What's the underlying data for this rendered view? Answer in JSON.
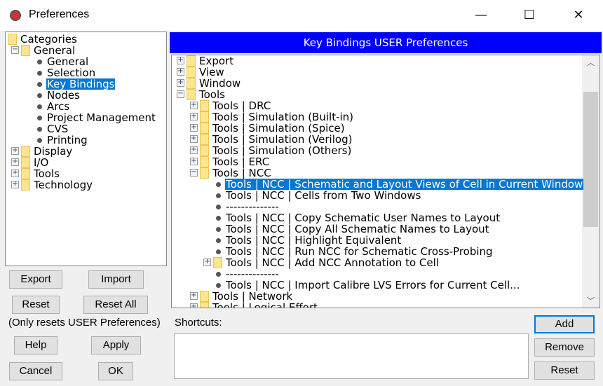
{
  "window": {
    "title": "Preferences",
    "minimize": "—",
    "maximize": "☐",
    "close": "✕"
  },
  "categories": [
    {
      "label": "Categories",
      "level": 0,
      "type": "folder"
    },
    {
      "label": "General",
      "level": 1,
      "type": "folder",
      "expanded": true
    },
    {
      "label": "General",
      "level": 2,
      "type": "leaf"
    },
    {
      "label": "Selection",
      "level": 2,
      "type": "leaf"
    },
    {
      "label": "Key Bindings",
      "level": 2,
      "type": "leaf",
      "selected": true
    },
    {
      "label": "Nodes",
      "level": 2,
      "type": "leaf"
    },
    {
      "label": "Arcs",
      "level": 2,
      "type": "leaf"
    },
    {
      "label": "Project Management",
      "level": 2,
      "type": "leaf"
    },
    {
      "label": "CVS",
      "level": 2,
      "type": "leaf"
    },
    {
      "label": "Printing",
      "level": 2,
      "type": "leaf"
    },
    {
      "label": "Display",
      "level": 1,
      "type": "folder",
      "expanded": false
    },
    {
      "label": "I/O",
      "level": 1,
      "type": "folder",
      "expanded": false
    },
    {
      "label": "Tools",
      "level": 1,
      "type": "folder",
      "expanded": false
    },
    {
      "label": "Technology",
      "level": 1,
      "type": "folder",
      "expanded": false
    }
  ],
  "left_buttons": {
    "export": "Export",
    "import": "Import",
    "reset": "Reset",
    "reset_all": "Reset All",
    "note": "(Only resets USER Preferences)",
    "help": "Help",
    "apply": "Apply",
    "cancel": "Cancel",
    "ok": "OK"
  },
  "header": "Key Bindings USER Preferences",
  "bindings": [
    {
      "label": "Export",
      "level": 0,
      "type": "folder",
      "expanded": false
    },
    {
      "label": "View",
      "level": 0,
      "type": "folder",
      "expanded": false
    },
    {
      "label": "Window",
      "level": 0,
      "type": "folder",
      "expanded": false
    },
    {
      "label": "Tools",
      "level": 0,
      "type": "folder",
      "expanded": true
    },
    {
      "label": "Tools | DRC",
      "level": 1,
      "type": "folder",
      "expanded": false
    },
    {
      "label": "Tools | Simulation (Built-in)",
      "level": 1,
      "type": "folder",
      "expanded": false
    },
    {
      "label": "Tools | Simulation (Spice)",
      "level": 1,
      "type": "folder",
      "expanded": false
    },
    {
      "label": "Tools | Simulation (Verilog)",
      "level": 1,
      "type": "folder",
      "expanded": false
    },
    {
      "label": "Tools | Simulation (Others)",
      "level": 1,
      "type": "folder",
      "expanded": false
    },
    {
      "label": "Tools | ERC",
      "level": 1,
      "type": "folder",
      "expanded": false
    },
    {
      "label": "Tools | NCC",
      "level": 1,
      "type": "folder",
      "expanded": true
    },
    {
      "label": "Tools | NCC | Schematic and Layout Views of Cell in Current Window",
      "level": 2,
      "type": "leaf",
      "selected": true
    },
    {
      "label": "Tools | NCC | Cells from Two Windows",
      "level": 2,
      "type": "leaf"
    },
    {
      "label": "--------------",
      "level": 2,
      "type": "leaf"
    },
    {
      "label": "Tools | NCC | Copy Schematic User Names to Layout",
      "level": 2,
      "type": "leaf"
    },
    {
      "label": "Tools | NCC | Copy All Schematic Names to Layout",
      "level": 2,
      "type": "leaf"
    },
    {
      "label": "Tools | NCC | Highlight Equivalent",
      "level": 2,
      "type": "leaf"
    },
    {
      "label": "Tools | NCC | Run NCC for Schematic Cross-Probing",
      "level": 2,
      "type": "leaf"
    },
    {
      "label": "Tools | NCC | Add NCC Annotation to Cell",
      "level": 2,
      "type": "folder",
      "expanded": false
    },
    {
      "label": "--------------",
      "level": 2,
      "type": "leaf"
    },
    {
      "label": "Tools | NCC | Import Calibre LVS Errors for Current Cell...",
      "level": 2,
      "type": "leaf"
    },
    {
      "label": "Tools | Network",
      "level": 1,
      "type": "folder",
      "expanded": false
    },
    {
      "label": "Tools | Logical Effort",
      "level": 1,
      "type": "folder",
      "expanded": false
    }
  ],
  "shortcuts": {
    "label": "Shortcuts:",
    "add": "Add",
    "remove": "Remove",
    "reset": "Reset"
  },
  "colors": {
    "header": "#0000ff",
    "selection": "#0078d7"
  }
}
